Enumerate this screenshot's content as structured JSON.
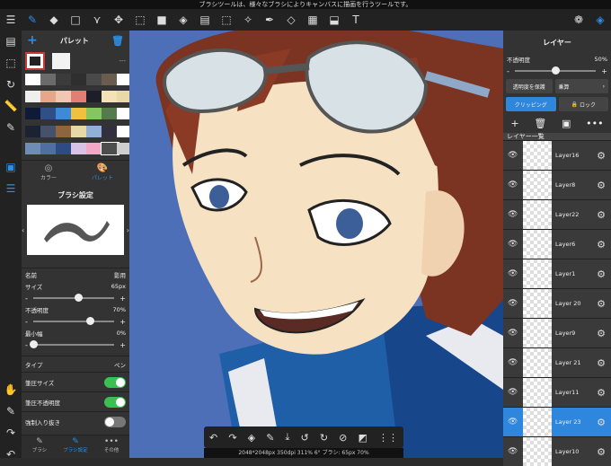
{
  "status_text": "ブラシツールは、様々なブラシによりキャンバスに描画を行うツールです。",
  "palette": {
    "title": "パレット",
    "tab_color": "カラー",
    "tab_palette": "パレット",
    "more": "---",
    "swatches": [
      "#ffffff",
      "#6b6b6b",
      "#3b3b3b",
      "#2f2f2f",
      "#4a4a4a",
      "#6a5c4f",
      "#ffffff",
      "#efefef",
      "#e8a58a",
      "#f0c6b5",
      "#e37e74",
      "#1c1e2a",
      "#f4e2b6",
      "#e9d9a9",
      "#0f1a36",
      "#2f4f86",
      "#3e8ad8",
      "#f0c13f",
      "#86c660",
      "#557b4d",
      "#ffffff",
      "#1b2333",
      "#44536b",
      "#8f6540",
      "#e7d9a6",
      "#90b0d8",
      "#32303f",
      "#ffffff",
      "#6f8db4",
      "#4f6fa0",
      "#2d4b84",
      "#d8c3e6",
      "#f3a8c6",
      "#4d4d4d",
      "#cfcfcf"
    ]
  },
  "brush": {
    "title": "ブラシ設定",
    "name_label": "名前",
    "name_value": "影用",
    "size_label": "サイズ",
    "size_value": "65px",
    "size_level": 0.55,
    "opacity_label": "不透明度",
    "opacity_value": "70%",
    "opacity_level": 0.7,
    "min_label": "最小幅",
    "min_value": "0%",
    "min_level": 0.0,
    "type_label": "タイプ",
    "type_value": "ペン",
    "pressure_size": "筆圧サイズ",
    "pressure_opacity": "筆圧不透明度",
    "force_start_end": "強制入り抜き",
    "footer": [
      "ブラシ",
      "ブラシ設定",
      "その他"
    ]
  },
  "layers": {
    "title": "レイヤー",
    "opacity_label": "不透明度",
    "opacity_value": "50%",
    "opacity_level": 0.5,
    "protect": "透明度を保護",
    "blend": "乗算",
    "clipping": "クリッピング",
    "lock": "ロック",
    "list_title": "レイヤー一覧",
    "items": [
      {
        "name": "Layer16"
      },
      {
        "name": "Layer8"
      },
      {
        "name": "Layer22"
      },
      {
        "name": "Layer6"
      },
      {
        "name": "Layer1"
      },
      {
        "name": "Layer 20"
      },
      {
        "name": "Layer9"
      },
      {
        "name": "Layer 21"
      },
      {
        "name": "Layer11"
      },
      {
        "name": "Layer 23"
      },
      {
        "name": "Layer10"
      }
    ]
  },
  "canvas_info": "2048*2048px 350dpi 311% 6° ブラシ: 65px 70%"
}
